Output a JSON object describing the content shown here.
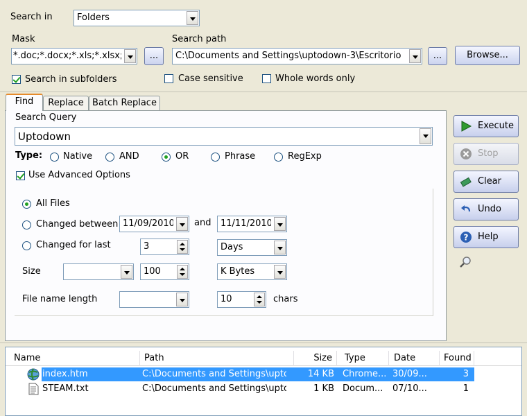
{
  "top": {
    "search_in_label": "Search in",
    "search_in_value": "Folders",
    "mask_label": "Mask",
    "mask_value": "*.doc;*.docx;*.xls;*.xlsx;*.h",
    "mask_browse_label": "...",
    "search_path_label": "Search path",
    "search_path_value": "C:\\Documents and Settings\\uptodown-3\\Escritorio",
    "path_browse_label": "...",
    "browse_label": "Browse...",
    "subfolders_label": "Search in subfolders",
    "subfolders_checked": true,
    "case_label": "Case sensitive",
    "case_checked": false,
    "whole_label": "Whole words only",
    "whole_checked": false
  },
  "tabs": [
    {
      "label": "Find",
      "active": true
    },
    {
      "label": "Replace",
      "active": false
    },
    {
      "label": "Batch Replace",
      "active": false
    }
  ],
  "find": {
    "query_label": "Search Query",
    "query_value": "Uptodown",
    "type_label": "Type:",
    "types": [
      {
        "label": "Native",
        "selected": false
      },
      {
        "label": "AND",
        "selected": false
      },
      {
        "label": "OR",
        "selected": true
      },
      {
        "label": "Phrase",
        "selected": false
      },
      {
        "label": "RegExp",
        "selected": false
      }
    ],
    "advanced_label": "Use Advanced Options",
    "advanced_checked": true
  },
  "advanced": {
    "all_files_label": "All Files",
    "changed_between_label": "Changed between",
    "date_from": "11/09/2010",
    "and_label": "and",
    "date_to": "11/11/2010",
    "changed_last_label": "Changed for last",
    "last_value": "3",
    "last_unit": "Days",
    "size_label": "Size",
    "size_op": "",
    "size_value": "100",
    "size_unit": "K Bytes",
    "fnlen_label": "File name length",
    "fnlen_op": "",
    "fnlen_value": "10",
    "chars_label": "chars"
  },
  "actions": {
    "execute": "Execute",
    "stop": "Stop",
    "clear": "Clear",
    "undo": "Undo",
    "help": "Help"
  },
  "results": {
    "columns": [
      "Name",
      "Path",
      "Size",
      "Type",
      "Date",
      "Found"
    ],
    "rows": [
      {
        "name": "index.htm",
        "path": "C:\\Documents and Settings\\upto...",
        "size": "14 KB",
        "type": "Chrome...",
        "date": "30/09...",
        "found": "3",
        "selected": true,
        "icon": "web-page-icon"
      },
      {
        "name": "STEAM.txt",
        "path": "C:\\Documents and Settings\\upto...",
        "size": "1 KB",
        "type": "Docum...",
        "date": "07/10...",
        "found": "1",
        "selected": false,
        "icon": "text-file-icon"
      }
    ]
  },
  "colors": {
    "background": "#ece9d8",
    "selection": "#3399ff",
    "accent_tab": "#e68b2c",
    "check_green": "#21a121"
  }
}
